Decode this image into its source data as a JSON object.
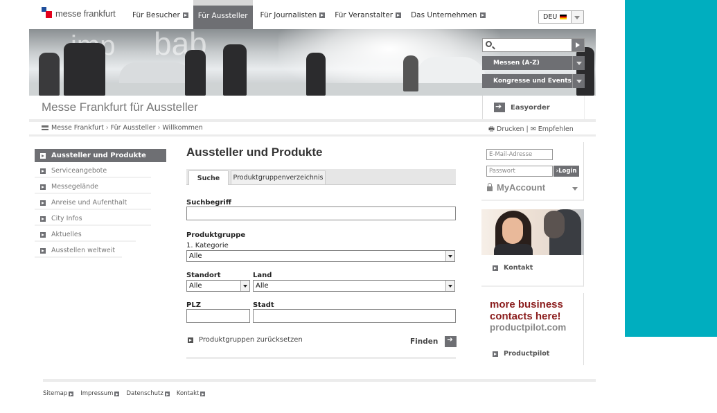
{
  "header": {
    "logo_text": "messe frankfurt",
    "nav": [
      {
        "label": "Für Besucher",
        "active": false
      },
      {
        "label": "Für Aussteller",
        "active": true
      },
      {
        "label": "Für Journalisten",
        "active": false
      },
      {
        "label": "Für Veranstalter",
        "active": false
      },
      {
        "label": "Das Unternehmen",
        "active": false
      }
    ],
    "language": "DEU"
  },
  "banner": {
    "dropdown_fairs": "Messen (A-Z)",
    "dropdown_congress": "Kongresse und Events"
  },
  "page_title": "Messe Frankfurt für Aussteller",
  "easyorder": "Easyorder",
  "breadcrumb": [
    "Messe Frankfurt",
    "Für Aussteller",
    "Willkommen"
  ],
  "tools": {
    "print": "Drucken",
    "recommend": "Empfehlen",
    "separator": "|"
  },
  "sidebar": {
    "items": [
      {
        "label": "Aussteller und Produkte",
        "active": true
      },
      {
        "label": "Serviceangebote",
        "active": false
      },
      {
        "label": "Messegelände",
        "active": false
      },
      {
        "label": "Anreise und Aufenthalt",
        "active": false
      },
      {
        "label": "City Infos",
        "active": false
      },
      {
        "label": "Aktuelles",
        "active": false
      },
      {
        "label": "Ausstellen weltweit",
        "active": false
      }
    ]
  },
  "main": {
    "heading": "Aussteller und Produkte",
    "tabs": [
      "Suche",
      "Produktgruppenverzeichnis"
    ],
    "search_term_label": "Suchbegriff",
    "product_group_label": "Produktgruppe",
    "category_label": "1. Kategorie",
    "category_value": "Alle",
    "location_label": "Standort",
    "location_value": "Alle",
    "country_label": "Land",
    "country_value": "Alle",
    "zip_label": "PLZ",
    "city_label": "Stadt",
    "reset_label": "Produktgruppen zurücksetzen",
    "find_label": "Finden"
  },
  "login": {
    "email_placeholder": "E-Mail-Adresse",
    "password_placeholder": "Passwort",
    "login_button": "Login",
    "myaccount": "MyAccount"
  },
  "contact": {
    "label": "Kontakt"
  },
  "promo": {
    "line1": "more business",
    "line2": "contacts here!",
    "line3": "productpilot.com",
    "link": "Productpilot"
  },
  "footer": {
    "links": [
      "Sitemap",
      "Impressum",
      "Datenschutz",
      "Kontakt"
    ]
  },
  "colors": {
    "accent_teal": "#00aebf",
    "nav_grey": "#6e6f73",
    "promo_red": "#8b1d1d"
  }
}
